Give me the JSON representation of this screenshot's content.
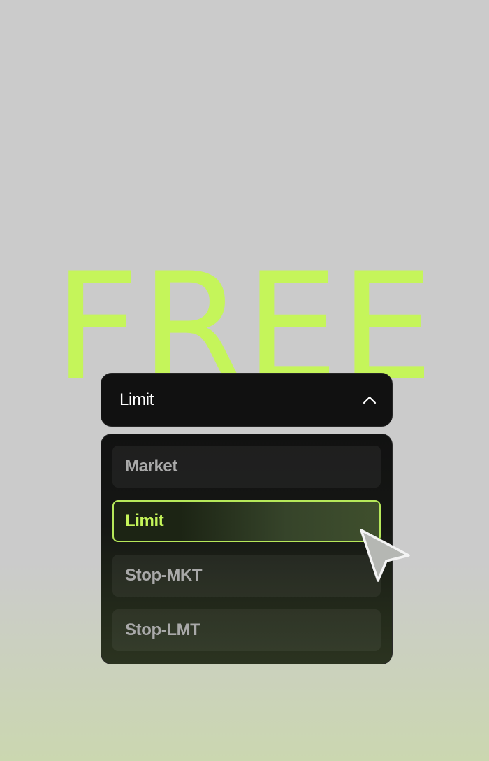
{
  "hero": {
    "word": "FREE"
  },
  "select": {
    "value": "Limit",
    "chevron_icon": "chevron-up-icon",
    "options": [
      {
        "label": "Market",
        "selected": false
      },
      {
        "label": "Limit",
        "selected": true
      },
      {
        "label": "Stop-MKT",
        "selected": false
      },
      {
        "label": "Stop-LMT",
        "selected": false
      }
    ]
  },
  "pointer_icon": "cursor-arrow-icon",
  "colors": {
    "accent": "#c5f55a",
    "panel": "#111111",
    "background": "#cbcbcb",
    "option_text": "#a9a9a9"
  }
}
